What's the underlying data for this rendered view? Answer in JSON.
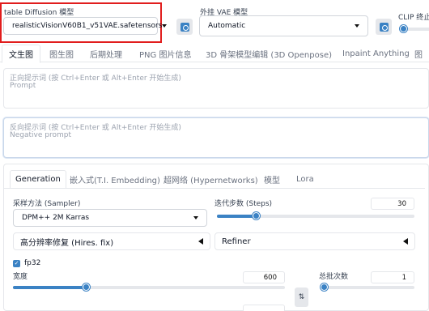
{
  "top": {
    "checkpoint_label": "table Diffusion 模型",
    "checkpoint_value": "realisticVisionV60B1_v51VAE.safetensors",
    "vae_label": "外挂 VAE 模型",
    "vae_value": "Automatic",
    "clip_label": "CLIP 终止"
  },
  "tabs": [
    "文生图",
    "图生图",
    "后期处理",
    "PNG 图片信息",
    "3D 骨架模型编辑 (3D Openpose)",
    "Inpaint Anything",
    "图"
  ],
  "prompt": {
    "positive_hint": "正向提示词 (按 Ctrl+Enter 或 Alt+Enter 开始生成)",
    "positive_placeholder": "Prompt",
    "negative_hint": "反向提示词 (按 Ctrl+Enter 或 Alt+Enter 开始生成)",
    "negative_placeholder": "Negative prompt"
  },
  "subtabs": [
    "Generation",
    "嵌入式(T.I. Embedding)",
    "超网络 (Hypernetworks)",
    "模型",
    "Lora"
  ],
  "gen": {
    "sampler_label": "采样方法 (Sampler)",
    "sampler_value": "DPM++ 2M Karras",
    "steps_label": "迭代步数 (Steps)",
    "steps_value": "30",
    "steps_level": 0.2,
    "hires_label": "高分辨率修复 (Hires. fix)",
    "refiner_label": "Refiner",
    "fp32_label": "fp32",
    "width_label": "宽度",
    "width_value": "600",
    "width_level": 0.27,
    "batch_count_label": "总批次数",
    "batch_count_value": "1",
    "batch_count_level": 0.0
  },
  "colors": {
    "accent": "#3b82c4",
    "highlight": "#e11d1d"
  }
}
